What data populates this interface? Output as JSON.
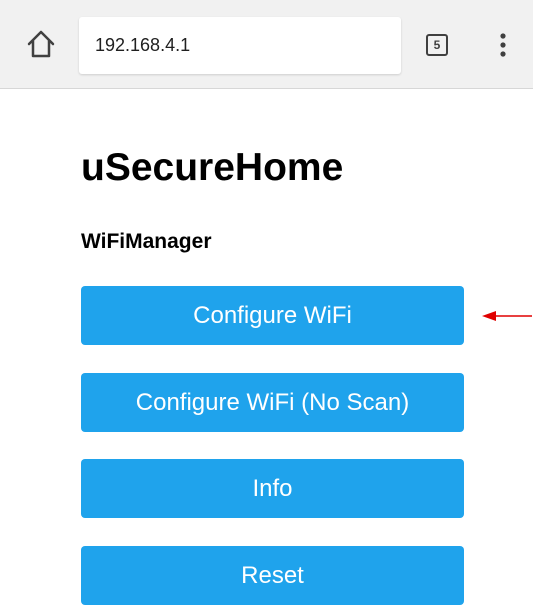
{
  "browser": {
    "url": "192.168.4.1",
    "tab_count": "5",
    "home_icon": "home-icon",
    "menu_icon": "more-vert-icon"
  },
  "page": {
    "title": "uSecureHome",
    "subtitle": "WiFiManager"
  },
  "buttons": [
    {
      "label": "Configure WiFi"
    },
    {
      "label": "Configure WiFi (No Scan)"
    },
    {
      "label": "Info"
    },
    {
      "label": "Reset"
    }
  ],
  "colors": {
    "button_bg": "#1fa3ec",
    "button_text": "#ffffff",
    "annotation_arrow": "#e00000",
    "toolbar_bg": "#f1f1f1"
  }
}
